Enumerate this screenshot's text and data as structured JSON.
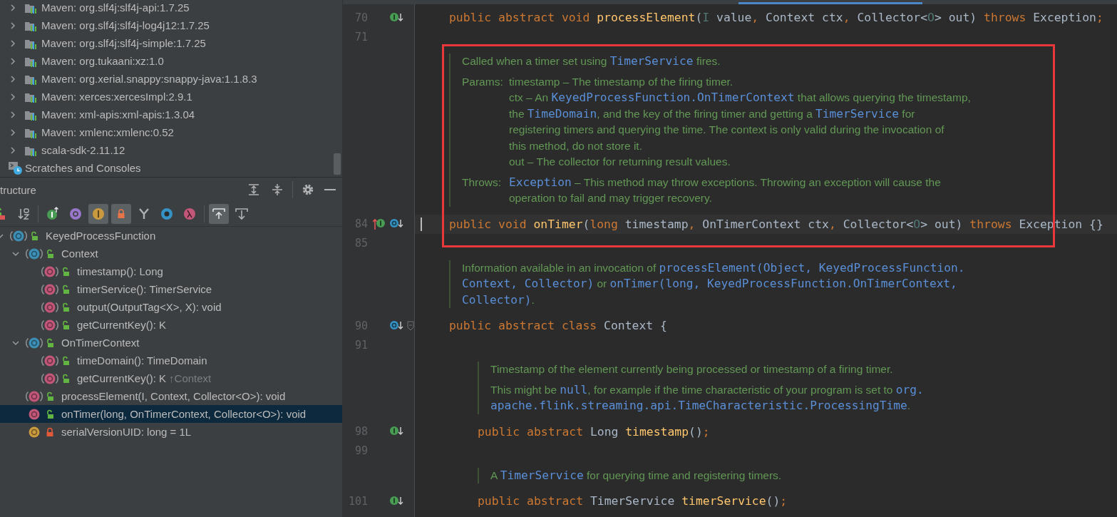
{
  "project_tree": {
    "items": [
      {
        "kind": "library",
        "label": "Maven: org.slf4j:slf4j-api:1.7.25",
        "expanded": false
      },
      {
        "kind": "library",
        "label": "Maven: org.slf4j:slf4j-log4j12:1.7.25",
        "expanded": false
      },
      {
        "kind": "library",
        "label": "Maven: org.slf4j:slf4j-simple:1.7.25",
        "expanded": false
      },
      {
        "kind": "library",
        "label": "Maven: org.tukaani:xz:1.0",
        "expanded": false
      },
      {
        "kind": "library",
        "label": "Maven: org.xerial.snappy:snappy-java:1.1.8.3",
        "expanded": false
      },
      {
        "kind": "library",
        "label": "Maven: xerces:xercesImpl:2.9.1",
        "expanded": false
      },
      {
        "kind": "library",
        "label": "Maven: xml-apis:xml-apis:1.3.04",
        "expanded": false
      },
      {
        "kind": "library",
        "label": "Maven: xmlenc:xmlenc:0.52",
        "expanded": false
      },
      {
        "kind": "library",
        "label": "scala-sdk-2.11.12",
        "expanded": false
      },
      {
        "kind": "scratches",
        "label": "Scratches and Consoles"
      }
    ]
  },
  "structure": {
    "title": "tructure",
    "toolbar": [
      [
        {
          "kind": "visibility",
          "selected": false
        },
        {
          "kind": "sort-alpha",
          "selected": false
        }
      ],
      [
        {
          "kind": "inherited",
          "selected": false
        },
        {
          "kind": "properties",
          "selected": false
        },
        {
          "kind": "fields",
          "selected": true
        },
        {
          "kind": "non-public",
          "selected": true
        },
        {
          "kind": "fork",
          "selected": false
        },
        {
          "kind": "anonymous",
          "selected": false
        },
        {
          "kind": "lambda",
          "selected": false
        }
      ],
      [
        {
          "kind": "autoscroll-to-source",
          "selected": true
        },
        {
          "kind": "autoscroll-from-source",
          "selected": false
        }
      ]
    ],
    "tree": [
      {
        "kind": "class",
        "abstract": true,
        "private": false,
        "label": "KeyedProcessFunction",
        "expanded": true,
        "selected": false,
        "children": [
          {
            "kind": "class",
            "abstract": true,
            "private": false,
            "label": "Context",
            "expanded": true,
            "selected": false,
            "children": [
              {
                "kind": "method",
                "abstract": true,
                "private": false,
                "label": "timestamp(): Long",
                "selected": false
              },
              {
                "kind": "method",
                "abstract": true,
                "private": false,
                "label": "timerService(): TimerService",
                "selected": false
              },
              {
                "kind": "method",
                "abstract": true,
                "private": false,
                "label": "output(OutputTag<X>, X): void",
                "selected": false
              },
              {
                "kind": "method",
                "abstract": true,
                "private": false,
                "label": "getCurrentKey(): K",
                "selected": false
              }
            ]
          },
          {
            "kind": "class",
            "abstract": true,
            "private": false,
            "label": "OnTimerContext",
            "expanded": true,
            "selected": false,
            "children": [
              {
                "kind": "method",
                "abstract": true,
                "private": false,
                "label": "timeDomain(): TimeDomain",
                "selected": false
              },
              {
                "kind": "method",
                "abstract": true,
                "private": false,
                "label": "getCurrentKey(): K",
                "suffix": "↑Context",
                "selected": false
              }
            ]
          },
          {
            "kind": "method",
            "abstract": true,
            "private": false,
            "label": "processElement(I, Context, Collector<O>): void",
            "selected": false
          },
          {
            "kind": "method",
            "abstract": false,
            "private": false,
            "label": "onTimer(long, OnTimerContext, Collector<O>): void",
            "selected": true
          },
          {
            "kind": "field",
            "private": true,
            "label": "serialVersionUID: long = 1L",
            "selected": false
          }
        ]
      }
    ]
  },
  "editor": {
    "annotation": {
      "kind": "rectangle"
    },
    "rows": [
      {
        "kind": "code",
        "number": "70",
        "implements_super": false,
        "has_implementations": true,
        "has_overrides": false,
        "tokens": [
          {
            "text": "public abstract void ",
            "kind": "keyword"
          },
          {
            "text": "processElement",
            "kind": "method"
          },
          {
            "text": "(",
            "kind": "identifier"
          },
          {
            "text": "I",
            "kind": "type-parameter"
          },
          {
            "text": " value",
            "kind": "identifier"
          },
          {
            "text": ", ",
            "kind": "punctuation"
          },
          {
            "text": "Context ctx",
            "kind": "identifier"
          },
          {
            "text": ", ",
            "kind": "punctuation"
          },
          {
            "text": "Collector<",
            "kind": "identifier"
          },
          {
            "text": "O",
            "kind": "type-parameter"
          },
          {
            "text": "> out) ",
            "kind": "identifier"
          },
          {
            "text": "throws ",
            "kind": "keyword"
          },
          {
            "text": "Exception",
            "kind": "identifier"
          },
          {
            "text": ";",
            "kind": "punctuation"
          }
        ]
      },
      {
        "kind": "code",
        "number": "71",
        "implements_super": false,
        "has_implementations": false,
        "has_overrides": false
      },
      {
        "kind": "doc",
        "sections": [
          {
            "lines": [
              [
                {
                  "text": "Called when a timer set using ",
                  "kind": "text"
                },
                {
                  "text": "TimerService",
                  "kind": "code"
                },
                {
                  "text": " fires.",
                  "kind": "text"
                }
              ]
            ]
          },
          {
            "label": "Params:",
            "lines": [
              [
                {
                  "text": "timestamp – The timestamp of the firing timer.",
                  "kind": "text"
                }
              ],
              [
                {
                  "text": "ctx – An ",
                  "kind": "text"
                },
                {
                  "text": "KeyedProcessFunction.OnTimerContext",
                  "kind": "code"
                },
                {
                  "text": " that allows querying the timestamp,",
                  "kind": "text"
                }
              ],
              [
                {
                  "text": "the ",
                  "kind": "text"
                },
                {
                  "text": "TimeDomain",
                  "kind": "code"
                },
                {
                  "text": ", and the key of the firing timer and getting a ",
                  "kind": "text"
                },
                {
                  "text": "TimerService",
                  "kind": "code"
                },
                {
                  "text": " for",
                  "kind": "text"
                }
              ],
              [
                {
                  "text": "registering timers and querying the time. The context is only valid during the invocation of",
                  "kind": "text"
                }
              ],
              [
                {
                  "text": "this method, do not store it.",
                  "kind": "text"
                }
              ],
              [
                {
                  "text": "out – The collector for returning result values.",
                  "kind": "text"
                }
              ]
            ]
          },
          {
            "label": "Throws:",
            "lines": [
              [
                {
                  "text": "Exception",
                  "kind": "code"
                },
                {
                  "text": " – This method may throw exceptions. Throwing an exception will cause the",
                  "kind": "text"
                }
              ],
              [
                {
                  "text": "operation to fail and may trigger recovery.",
                  "kind": "text"
                }
              ]
            ]
          }
        ]
      },
      {
        "kind": "code",
        "number": "84",
        "implements_super": true,
        "has_implementations": false,
        "has_overrides": true,
        "current": true,
        "tokens": [
          {
            "text": "public void ",
            "kind": "keyword"
          },
          {
            "text": "onTimer",
            "kind": "method"
          },
          {
            "text": "(",
            "kind": "identifier"
          },
          {
            "text": "long ",
            "kind": "keyword"
          },
          {
            "text": "timestamp",
            "kind": "identifier"
          },
          {
            "text": ", ",
            "kind": "punctuation"
          },
          {
            "text": "OnTimerContext ctx",
            "kind": "identifier"
          },
          {
            "text": ", ",
            "kind": "punctuation"
          },
          {
            "text": "Collector<",
            "kind": "identifier"
          },
          {
            "text": "O",
            "kind": "type-parameter"
          },
          {
            "text": "> out) ",
            "kind": "identifier"
          },
          {
            "text": "throws ",
            "kind": "keyword"
          },
          {
            "text": "Exception {}",
            "kind": "identifier"
          }
        ]
      },
      {
        "kind": "code",
        "number": "85",
        "implements_super": false,
        "has_implementations": false,
        "has_overrides": false
      },
      {
        "kind": "doc",
        "sections": [
          {
            "lines": [
              [
                {
                  "text": "Information available in an invocation of ",
                  "kind": "text"
                },
                {
                  "text": "processElement(Object, KeyedProcessFunction.",
                  "kind": "code"
                }
              ],
              [
                {
                  "text": "Context, Collector)",
                  "kind": "code"
                },
                {
                  "text": " or ",
                  "kind": "text"
                },
                {
                  "text": "onTimer(long, KeyedProcessFunction.OnTimerContext,",
                  "kind": "code"
                }
              ],
              [
                {
                  "text": "Collector)",
                  "kind": "code"
                },
                {
                  "text": ".",
                  "kind": "text"
                }
              ]
            ]
          }
        ]
      },
      {
        "kind": "code",
        "number": "90",
        "implements_super": false,
        "has_implementations": false,
        "has_overrides": true,
        "foldable": true,
        "tokens": [
          {
            "text": "public abstract class ",
            "kind": "keyword"
          },
          {
            "text": "Context {",
            "kind": "identifier"
          }
        ],
        "children": [
          {
            "kind": "code",
            "number": "91",
            "implements_super": false,
            "has_implementations": false,
            "has_overrides": false
          },
          {
            "kind": "doc",
            "sections": [
              {
                "lines": [
                  [
                    {
                      "text": "Timestamp of the element currently being processed or timestamp of a firing timer.",
                      "kind": "text"
                    }
                  ]
                ]
              },
              {
                "lines": [
                  [
                    {
                      "text": "This might be ",
                      "kind": "text"
                    },
                    {
                      "text": "null",
                      "kind": "code"
                    },
                    {
                      "text": ", for example if the time characteristic of your program is set to ",
                      "kind": "text"
                    },
                    {
                      "text": "org.",
                      "kind": "code"
                    }
                  ],
                  [
                    {
                      "text": "apache.flink.streaming.api.TimeCharacteristic.ProcessingTime",
                      "kind": "code"
                    },
                    {
                      "text": ".",
                      "kind": "text"
                    }
                  ]
                ]
              }
            ]
          },
          {
            "kind": "code",
            "number": "98",
            "implements_super": false,
            "has_implementations": true,
            "has_overrides": false,
            "tokens": [
              {
                "text": "public abstract ",
                "kind": "keyword"
              },
              {
                "text": "Long ",
                "kind": "identifier"
              },
              {
                "text": "timestamp",
                "kind": "method"
              },
              {
                "text": "()",
                "kind": "identifier"
              },
              {
                "text": ";",
                "kind": "punctuation"
              }
            ]
          },
          {
            "kind": "code",
            "number": "99",
            "implements_super": false,
            "has_implementations": false,
            "has_overrides": false
          },
          {
            "kind": "doc",
            "sections": [
              {
                "lines": [
                  [
                    {
                      "text": "A ",
                      "kind": "text"
                    },
                    {
                      "text": "TimerService",
                      "kind": "code"
                    },
                    {
                      "text": " for querying time and registering timers.",
                      "kind": "text"
                    }
                  ]
                ]
              }
            ]
          },
          {
            "kind": "code",
            "number": "101",
            "implements_super": false,
            "has_implementations": true,
            "has_overrides": false,
            "tokens": [
              {
                "text": "public abstract ",
                "kind": "keyword"
              },
              {
                "text": "TimerService ",
                "kind": "identifier"
              },
              {
                "text": "timerService",
                "kind": "method"
              },
              {
                "text": "()",
                "kind": "identifier"
              },
              {
                "text": ";",
                "kind": "punctuation"
              }
            ]
          }
        ]
      }
    ]
  }
}
